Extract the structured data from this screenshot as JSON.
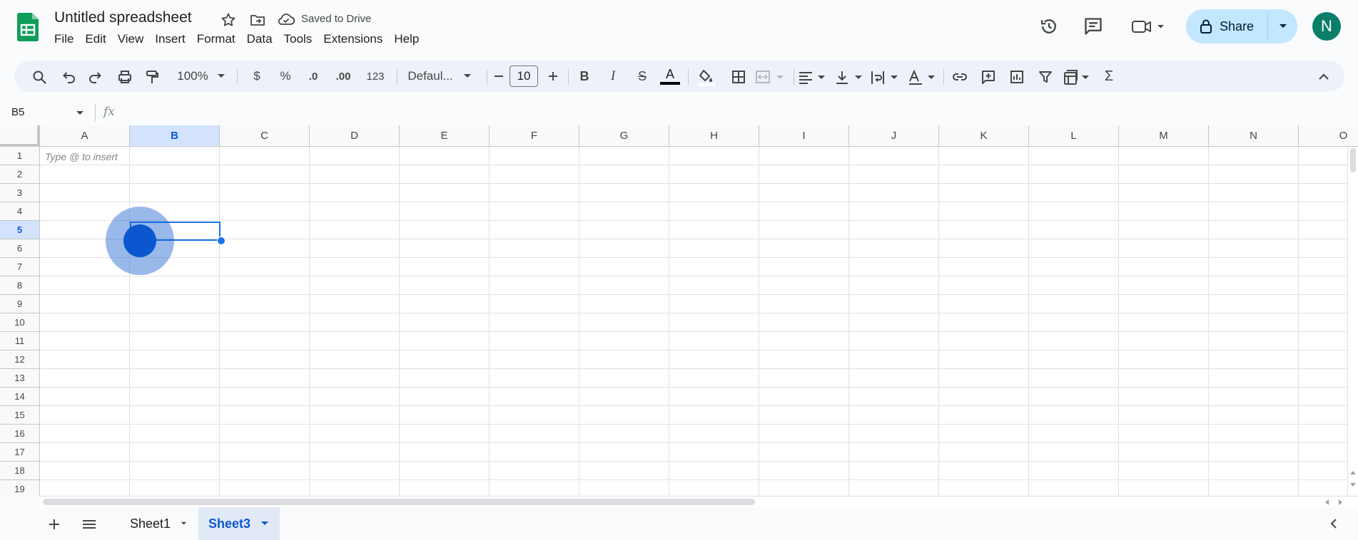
{
  "header": {
    "title": "Untitled spreadsheet",
    "save_status": "Saved to Drive",
    "icons": [
      "sheets-logo-icon",
      "star-icon",
      "move-folder-icon",
      "cloud-saved-icon",
      "version-history-icon",
      "comments-icon",
      "meet-icon"
    ],
    "share_label": "Share",
    "avatar_initial": "N",
    "avatar_color": "#0b7e6a"
  },
  "menu": [
    "File",
    "Edit",
    "View",
    "Insert",
    "Format",
    "Data",
    "Tools",
    "Extensions",
    "Help"
  ],
  "toolbar": {
    "zoom": "100%",
    "currency": "$",
    "percent": "%",
    "decrease_decimal": ".0",
    "increase_decimal": ".00",
    "number_format": "123",
    "font": "Defaul...",
    "font_size": "10",
    "bold": "B",
    "italic": "I",
    "strike": "S",
    "text_color_letter": "A",
    "text_color": "#000000",
    "function": "Σ"
  },
  "formula_bar": {
    "name_box": "B5",
    "fx": "fx",
    "value": ""
  },
  "grid": {
    "columns": [
      "A",
      "B",
      "C",
      "D",
      "E",
      "F",
      "G",
      "H",
      "I",
      "J",
      "K",
      "L",
      "M",
      "N",
      "O"
    ],
    "rows": [
      "1",
      "2",
      "3",
      "4",
      "5",
      "6",
      "7",
      "8",
      "9",
      "10",
      "11",
      "12",
      "13",
      "14",
      "15",
      "16",
      "17",
      "18",
      "19"
    ],
    "selected_column": "B",
    "selected_row": "5",
    "cell_a1_hint": "Type @ to insert"
  },
  "sheets": {
    "tabs": [
      {
        "name": "Sheet1",
        "active": false
      },
      {
        "name": "Sheet3",
        "active": true
      }
    ]
  },
  "colors": {
    "accent": "#0b57d0",
    "selection_header": "#d3e3fd",
    "share_bg": "#c2e7ff",
    "toolbar_bg": "#edf2fa",
    "logo": "#0f9d58"
  }
}
